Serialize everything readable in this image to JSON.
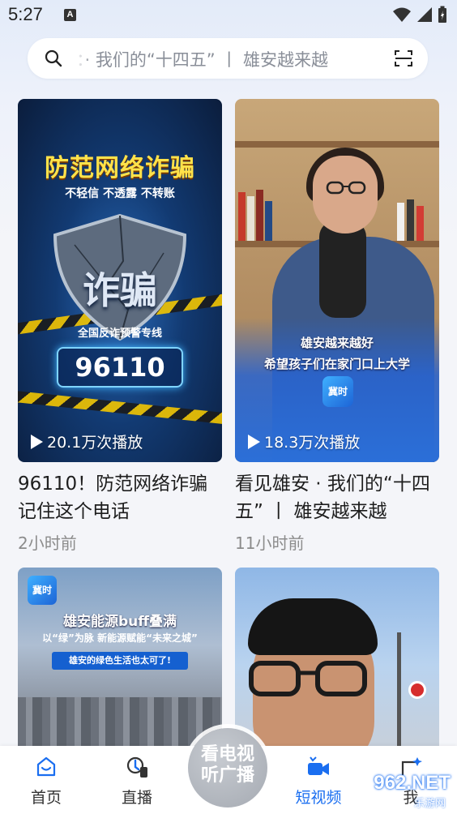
{
  "status_bar": {
    "time": "5:27",
    "notification_badge": "A"
  },
  "search": {
    "text": "：· 我们的“十四五” 丨 雄安越来越"
  },
  "feed": [
    {
      "title": "96110！防范网络诈骗 记住这个电话",
      "time": "2小时前",
      "plays": "20.1万次播放",
      "overlay": {
        "headline": "防范网络诈骗",
        "subline": "不轻信 不透露 不转账",
        "shield_text": "诈骗",
        "caption": "全国反诈预警专线",
        "number": "96110"
      }
    },
    {
      "title": "看见雄安 · 我们的“十四五” 丨 雄安越来越",
      "time": "11小时前",
      "plays": "18.3万次播放",
      "overlay": {
        "line1": "雄安越来越好",
        "line2": "希望孩子们在家门口上大学",
        "logo": "冀时"
      }
    },
    {
      "overlay": {
        "logo": "冀时",
        "headline": "雄安能源buff叠满",
        "subline": "以“绿”为脉 新能源赋能“未来之城”",
        "banner": "雄安的绿色生活也太可了!"
      }
    },
    {}
  ],
  "bottom_nav": {
    "items": [
      {
        "label": "首页",
        "icon": "home-icon"
      },
      {
        "label": "直播",
        "icon": "live-icon"
      },
      {
        "label": "短视频",
        "icon": "short-video-icon",
        "active": true
      },
      {
        "label": "我",
        "icon": "profile-icon"
      }
    ],
    "center": {
      "line1": "看电视",
      "line2": "听广播"
    }
  },
  "watermark": {
    "brand": "962.NET",
    "sub": "乐游网"
  },
  "colors": {
    "accent": "#1a6ef0",
    "background": "#f4f5f9"
  }
}
